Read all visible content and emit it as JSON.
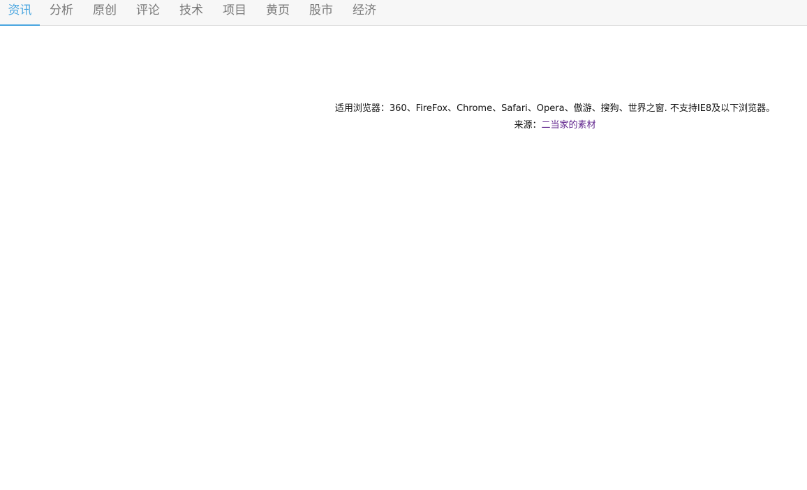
{
  "tabs": [
    {
      "label": "资讯",
      "active": true
    },
    {
      "label": "分析",
      "active": false
    },
    {
      "label": "原创",
      "active": false
    },
    {
      "label": "评论",
      "active": false
    },
    {
      "label": "技术",
      "active": false
    },
    {
      "label": "项目",
      "active": false
    },
    {
      "label": "黄页",
      "active": false
    },
    {
      "label": "股市",
      "active": false
    },
    {
      "label": "经济",
      "active": false
    }
  ],
  "info": {
    "browsers_text": "适用浏览器：360、FireFox、Chrome、Safari、Opera、傲游、搜狗、世界之窗. 不支持IE8及以下浏览器。",
    "source_label": "来源：",
    "source_link": "二当家的素材"
  },
  "colors": {
    "accent": "#4aa6e0",
    "tab_text": "#777777",
    "link": "#5c1f8a"
  }
}
